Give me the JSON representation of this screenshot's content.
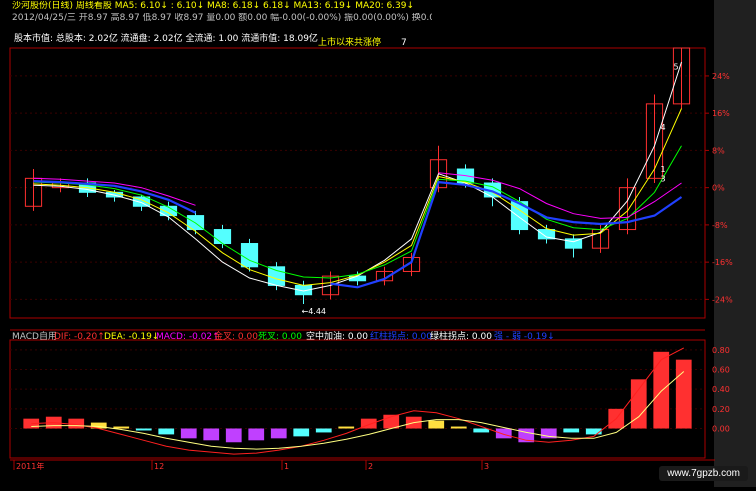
{
  "header": {
    "line1": "沙河股份(日线) 周线看股 MA5: 6.10↓  : 6.10↓ MA8: 6.18↓  6.18↓ MA13: 6.19↓ MA20: 6.39↓",
    "line2": "2012/04/25/三 开8.97 高8.97 低8.97 收8.97 量0.00 额0.00 幅-0.00(-0.00%) 振0.00(0.00%) 换0.00% 流通2.02亿",
    "line3": "股本市值: 总股本: 2.02亿 流通盘: 2.02亿 全流通: 1.00 流通市值: 18.09亿",
    "limit_label": "上市以来共涨停",
    "limit_value": "7"
  },
  "macd_header": {
    "name": "MACD自用",
    "dif": "DIF: -0.20↑",
    "dea": "DEA: -0.19↓",
    "macd": "MACD: -0.02↑",
    "golden": "金叉: 0.00",
    "dead": "死叉: 0.00",
    "airadd": "空中加油: 0.00",
    "red_turn": "红柱拐点: 0.00",
    "green_turn": "绿柱拐点: 0.00",
    "tail": "强 - 弱 -0.19↓"
  },
  "x_axis": {
    "labels": [
      "2011年",
      "12",
      "1",
      "2",
      "3"
    ]
  },
  "watermark": "www.7gpzb.com",
  "colors": {
    "bg": "#000000",
    "up": "#ff3030",
    "down": "#54ffff",
    "ma5": "#ffffff",
    "ma8": "#ffff00",
    "ma13": "#00ff00",
    "ma20": "#ff00ff",
    "ma_blue": "#2040ff",
    "border": "#aa0000"
  },
  "chart_data": [
    {
      "type": "candlestick",
      "y_ticks": [
        "24%",
        "16%",
        "8%",
        "0%",
        "-8%",
        "-16%",
        "-24%"
      ],
      "ylim": [
        -28,
        30
      ],
      "annotations": [
        "1",
        "3",
        "4",
        "5",
        "←4.44"
      ],
      "series": [
        {
          "name": "MA5",
          "values": [
            0.5,
            0.3,
            -0.4,
            -1.6,
            -3.2,
            -6.3,
            -11.0,
            -16.0,
            -19.4,
            -21.0,
            -22.2,
            -21.0,
            -19.0,
            -15.6,
            -11.0,
            3.0,
            1.0,
            -2.0,
            -6.4,
            -10.6,
            -11.6,
            -9.6,
            -2.8,
            9.0,
            27.0
          ]
        },
        {
          "name": "MA8",
          "values": [
            0.8,
            0.5,
            0.0,
            -1.0,
            -2.6,
            -5.4,
            -9.4,
            -14.0,
            -17.6,
            -19.6,
            -21.0,
            -20.4,
            -18.8,
            -16.0,
            -12.4,
            2.4,
            1.2,
            -1.0,
            -4.8,
            -8.8,
            -10.2,
            -9.8,
            -5.0,
            4.0,
            17.0
          ]
        },
        {
          "name": "MA13",
          "values": [
            1.2,
            1.0,
            0.6,
            -0.2,
            -1.6,
            -4.2,
            -7.6,
            -12.0,
            -15.6,
            -17.8,
            -19.2,
            -19.4,
            -18.6,
            -16.6,
            -13.6,
            1.8,
            1.4,
            0.2,
            -3.0,
            -6.8,
            -8.6,
            -9.0,
            -6.6,
            -1.0,
            9.0
          ]
        },
        {
          "name": "MA20",
          "values": [
            2.0,
            1.8,
            1.4,
            1.0,
            0.0,
            -1.8,
            -3.8,
            null,
            null,
            null,
            null,
            null,
            null,
            null,
            null,
            3.2,
            2.6,
            1.6,
            -0.2,
            -3.4,
            -5.6,
            -6.6,
            -6.4,
            -3.0,
            1.0
          ]
        },
        {
          "name": "MA_blue",
          "values": [
            1.4,
            1.2,
            0.8,
            0.4,
            -0.8,
            -2.6,
            -5.4,
            null,
            null,
            null,
            null,
            -20.6,
            -21.4,
            -19.6,
            -16.0,
            1.2,
            0.6,
            -0.8,
            -3.4,
            -6.4,
            -7.4,
            -7.8,
            -7.4,
            -6.0,
            -2.0
          ]
        }
      ],
      "candles": [
        {
          "o": -4.0,
          "c": 2.0,
          "h": 4.0,
          "l": -5.0
        },
        {
          "o": 0.0,
          "c": 1.0,
          "h": 2.0,
          "l": -1.0
        },
        {
          "o": 1.0,
          "c": -1.0,
          "h": 2.0,
          "l": -2.0
        },
        {
          "o": -1.0,
          "c": -2.0,
          "h": -0.5,
          "l": -3.0
        },
        {
          "o": -2.0,
          "c": -4.0,
          "h": -1.5,
          "l": -5.0
        },
        {
          "o": -4.0,
          "c": -6.0,
          "h": -3.0,
          "l": -7.0
        },
        {
          "o": -6.0,
          "c": -9.0,
          "h": -5.0,
          "l": -10.0
        },
        {
          "o": -9.0,
          "c": -12.0,
          "h": -8.0,
          "l": -13.0
        },
        {
          "o": -12.0,
          "c": -17.0,
          "h": -11.0,
          "l": -18.0
        },
        {
          "o": -17.0,
          "c": -21.0,
          "h": -16.0,
          "l": -22.0
        },
        {
          "o": -21.0,
          "c": -23.0,
          "h": -20.0,
          "l": -25.0
        },
        {
          "o": -23.0,
          "c": -19.0,
          "h": -18.0,
          "l": -24.0
        },
        {
          "o": -19.0,
          "c": -20.0,
          "h": -18.0,
          "l": -21.0
        },
        {
          "o": -20.0,
          "c": -18.0,
          "h": -17.0,
          "l": -21.0
        },
        {
          "o": -18.0,
          "c": -15.0,
          "h": -14.0,
          "l": -19.0
        },
        {
          "o": 0.0,
          "c": 6.0,
          "h": 9.0,
          "l": -1.0
        },
        {
          "o": 4.0,
          "c": 1.0,
          "h": 5.0,
          "l": 0.0
        },
        {
          "o": 1.0,
          "c": -2.0,
          "h": 2.0,
          "l": -4.0
        },
        {
          "o": -3.0,
          "c": -9.0,
          "h": -2.0,
          "l": -10.0
        },
        {
          "o": -9.0,
          "c": -11.0,
          "h": -8.0,
          "l": -12.0
        },
        {
          "o": -11.0,
          "c": -13.0,
          "h": -10.0,
          "l": -15.0
        },
        {
          "o": -13.0,
          "c": -9.0,
          "h": -8.0,
          "l": -14.0
        },
        {
          "o": -9.0,
          "c": 0.0,
          "h": 2.0,
          "l": -10.0
        },
        {
          "o": 2.0,
          "c": 18.0,
          "h": 20.0,
          "l": 1.0
        },
        {
          "o": 18.0,
          "c": 30.0,
          "h": 30.0,
          "l": 17.0
        }
      ]
    },
    {
      "type": "macd",
      "y_ticks": [
        "0.80",
        "0.60",
        "0.40",
        "0.20",
        "0.00"
      ],
      "ylim": [
        -0.3,
        0.9
      ],
      "histogram": [
        0.1,
        0.12,
        0.1,
        0.06,
        0.02,
        -0.02,
        -0.06,
        -0.1,
        -0.12,
        -0.14,
        -0.12,
        -0.1,
        -0.08,
        -0.04,
        0.02,
        0.1,
        0.14,
        0.12,
        0.08,
        0.02,
        -0.04,
        -0.1,
        -0.14,
        -0.1,
        -0.04,
        -0.06,
        0.2,
        0.5,
        0.78,
        0.7
      ],
      "dif": [
        0.05,
        0.06,
        0.04,
        0.0,
        -0.06,
        -0.12,
        -0.18,
        -0.22,
        -0.24,
        -0.26,
        -0.25,
        -0.22,
        -0.18,
        -0.12,
        -0.05,
        0.04,
        0.12,
        0.18,
        0.16,
        0.1,
        0.02,
        -0.06,
        -0.12,
        -0.14,
        -0.12,
        -0.08,
        0.1,
        0.4,
        0.7,
        0.82
      ],
      "dea": [
        0.02,
        0.03,
        0.03,
        0.02,
        -0.01,
        -0.05,
        -0.1,
        -0.14,
        -0.18,
        -0.2,
        -0.21,
        -0.2,
        -0.18,
        -0.15,
        -0.11,
        -0.06,
        0.0,
        0.06,
        0.09,
        0.09,
        0.06,
        0.01,
        -0.04,
        -0.08,
        -0.1,
        -0.1,
        -0.04,
        0.12,
        0.38,
        0.58
      ]
    }
  ]
}
